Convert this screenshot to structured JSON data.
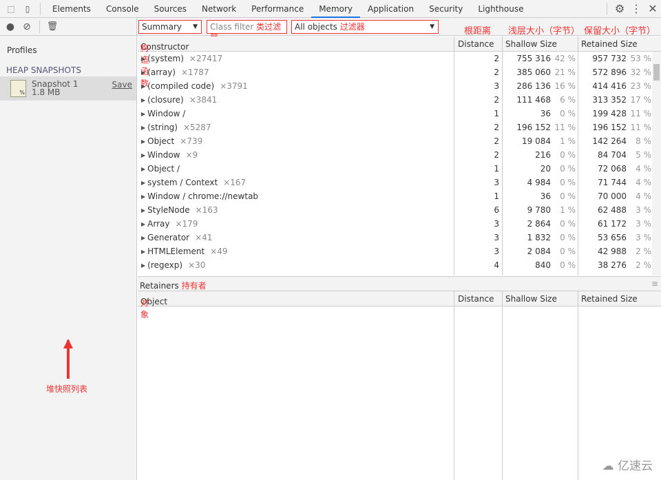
{
  "tabs": [
    "Elements",
    "Console",
    "Sources",
    "Network",
    "Performance",
    "Memory",
    "Application",
    "Security",
    "Lighthouse"
  ],
  "active_tab": "Memory",
  "toolbar": {
    "view": "Summary",
    "class_filter_placeholder": "Class filter",
    "class_filter_note": "类过滤器",
    "objects": "All objects",
    "objects_note": "过滤器"
  },
  "notes": {
    "distance": "根距离",
    "shallow": "浅层大小（字节）",
    "retained": "保留大小（字节）",
    "constructor": "构造函数",
    "object": "对象",
    "retainers": "持有者",
    "sidebar": "堆快照列表"
  },
  "sidebar": {
    "title": "Profiles",
    "section": "HEAP SNAPSHOTS",
    "snapshot_name": "Snapshot 1",
    "snapshot_size": "1.8 MB",
    "save": "Save"
  },
  "columns": {
    "constructor": "Constructor",
    "distance": "Distance",
    "shallow": "Shallow Size",
    "retained": "Retained Size",
    "object": "Object"
  },
  "retainers_title": "Retainers",
  "rows": [
    {
      "name": "(system)",
      "count": "×27417",
      "distance": "2",
      "shallow": "755 316",
      "shallow_pct": "42 %",
      "retained": "957 732",
      "retained_pct": "53 %"
    },
    {
      "name": "(array)",
      "count": "×1787",
      "distance": "2",
      "shallow": "385 060",
      "shallow_pct": "21 %",
      "retained": "572 896",
      "retained_pct": "32 %"
    },
    {
      "name": "(compiled code)",
      "count": "×3791",
      "distance": "3",
      "shallow": "286 136",
      "shallow_pct": "16 %",
      "retained": "414 416",
      "retained_pct": "23 %"
    },
    {
      "name": "(closure)",
      "count": "×3841",
      "distance": "2",
      "shallow": "111 468",
      "shallow_pct": "6 %",
      "retained": "313 352",
      "retained_pct": "17 %"
    },
    {
      "name": "Window /",
      "count": "",
      "distance": "1",
      "shallow": "36",
      "shallow_pct": "0 %",
      "retained": "199 428",
      "retained_pct": "11 %"
    },
    {
      "name": "(string)",
      "count": "×5287",
      "distance": "2",
      "shallow": "196 152",
      "shallow_pct": "11 %",
      "retained": "196 152",
      "retained_pct": "11 %"
    },
    {
      "name": "Object",
      "count": "×739",
      "distance": "2",
      "shallow": "19 084",
      "shallow_pct": "1 %",
      "retained": "142 264",
      "retained_pct": "8 %"
    },
    {
      "name": "Window",
      "count": "×9",
      "distance": "2",
      "shallow": "216",
      "shallow_pct": "0 %",
      "retained": "84 704",
      "retained_pct": "5 %"
    },
    {
      "name": "Object /",
      "count": "",
      "distance": "1",
      "shallow": "20",
      "shallow_pct": "0 %",
      "retained": "72 068",
      "retained_pct": "4 %"
    },
    {
      "name": "system / Context",
      "count": "×167",
      "distance": "3",
      "shallow": "4 984",
      "shallow_pct": "0 %",
      "retained": "71 744",
      "retained_pct": "4 %"
    },
    {
      "name": "Window / chrome://newtab",
      "count": "",
      "distance": "1",
      "shallow": "36",
      "shallow_pct": "0 %",
      "retained": "70 000",
      "retained_pct": "4 %"
    },
    {
      "name": "StyleNode",
      "count": "×163",
      "distance": "6",
      "shallow": "9 780",
      "shallow_pct": "1 %",
      "retained": "62 488",
      "retained_pct": "3 %"
    },
    {
      "name": "Array",
      "count": "×179",
      "distance": "3",
      "shallow": "2 864",
      "shallow_pct": "0 %",
      "retained": "61 172",
      "retained_pct": "3 %"
    },
    {
      "name": "Generator",
      "count": "×41",
      "distance": "3",
      "shallow": "1 832",
      "shallow_pct": "0 %",
      "retained": "53 656",
      "retained_pct": "3 %"
    },
    {
      "name": "HTMLElement",
      "count": "×49",
      "distance": "3",
      "shallow": "2 084",
      "shallow_pct": "0 %",
      "retained": "42 988",
      "retained_pct": "2 %"
    },
    {
      "name": "(regexp)",
      "count": "×30",
      "distance": "4",
      "shallow": "840",
      "shallow_pct": "0 %",
      "retained": "38 276",
      "retained_pct": "2 %"
    }
  ],
  "watermark": "亿速云",
  "colors": {
    "annotation": "#e33333",
    "accent": "#1a73e8"
  }
}
